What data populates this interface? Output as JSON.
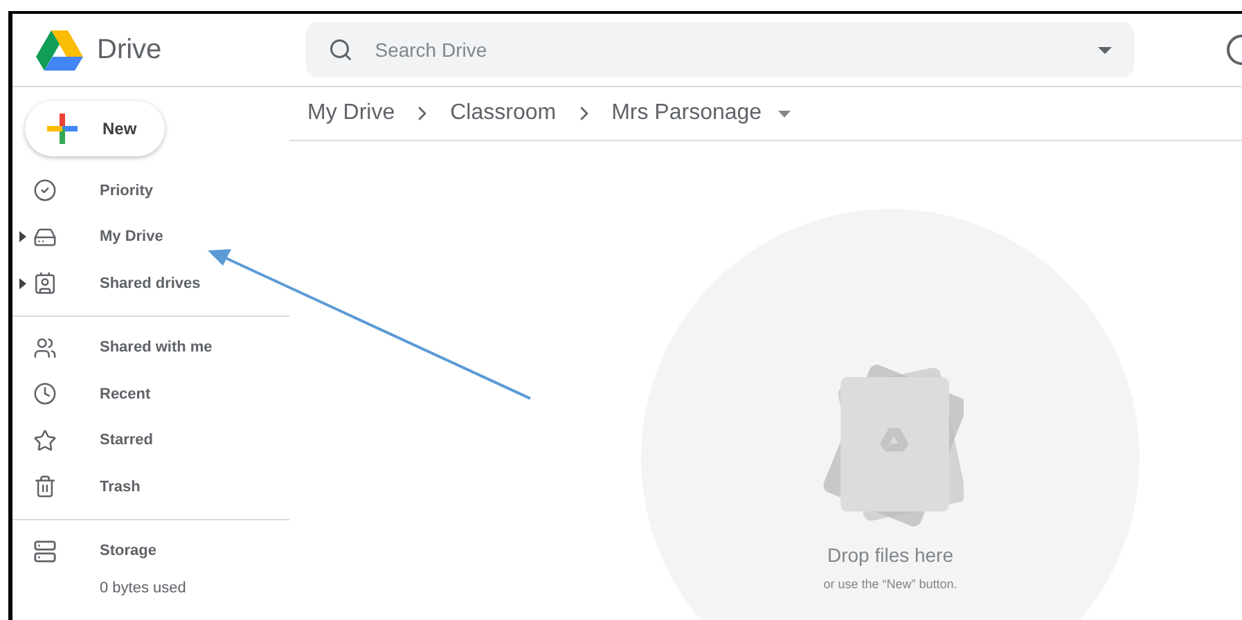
{
  "app": {
    "name": "Drive"
  },
  "search": {
    "placeholder": "Search Drive"
  },
  "new_button": {
    "label": "New"
  },
  "sidebar": {
    "groups": [
      [
        {
          "label": "Priority",
          "expandable": false
        },
        {
          "label": "My Drive",
          "expandable": true
        },
        {
          "label": "Shared drives",
          "expandable": true
        }
      ],
      [
        {
          "label": "Shared with me",
          "expandable": false
        },
        {
          "label": "Recent",
          "expandable": false
        },
        {
          "label": "Starred",
          "expandable": false
        },
        {
          "label": "Trash",
          "expandable": false
        }
      ]
    ],
    "storage": {
      "label": "Storage",
      "usage": "0 bytes used"
    }
  },
  "breadcrumb": [
    "My Drive",
    "Classroom",
    "Mrs Parsonage"
  ],
  "empty_state": {
    "title": "Drop files here",
    "hint": "or use the “New” button."
  }
}
